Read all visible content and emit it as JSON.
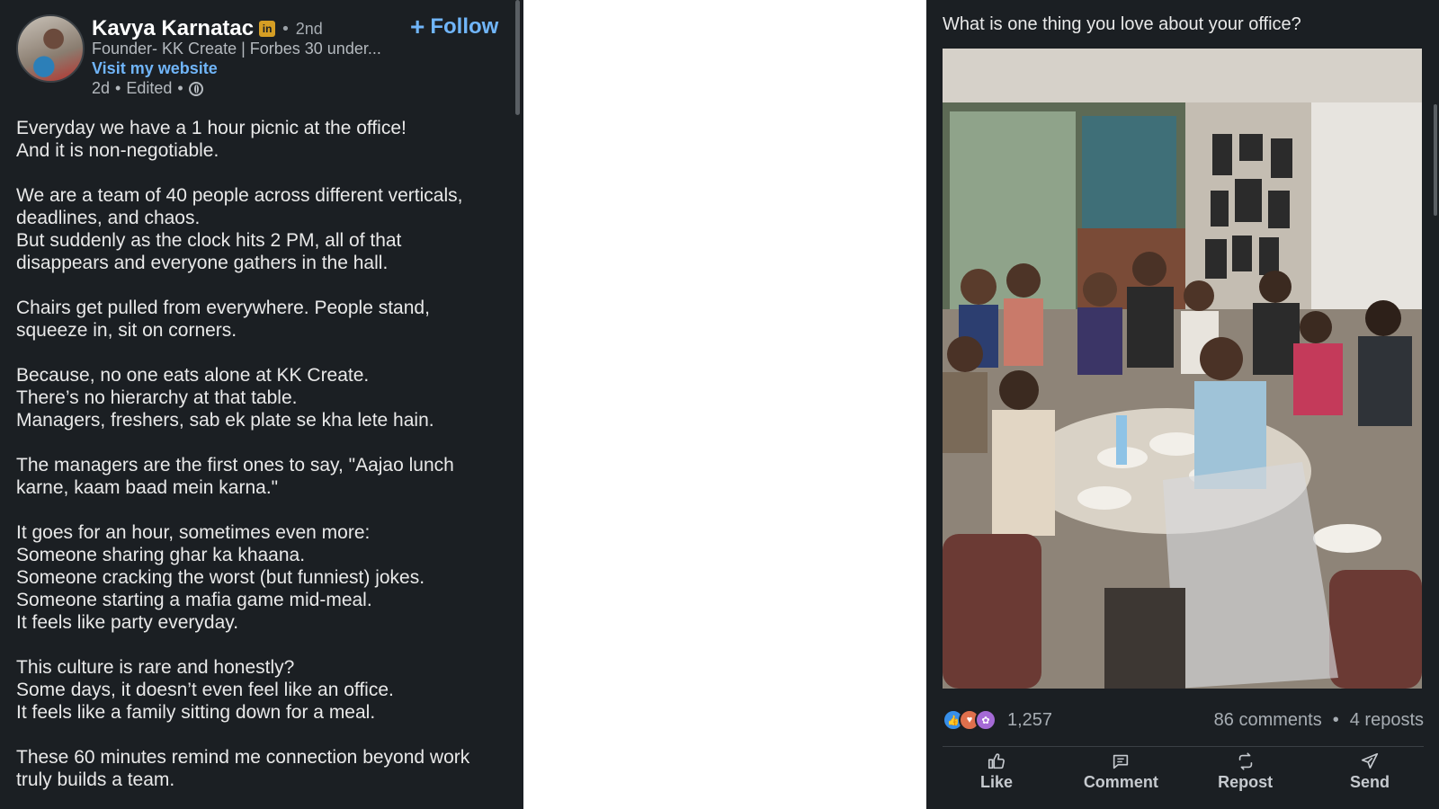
{
  "author": {
    "name": "Kavya Karnatac",
    "badge": "in",
    "degree": "2nd",
    "headline": "Founder- KK Create | Forbes 30 under...",
    "website_link": "Visit my website",
    "time": "2d",
    "edited": "Edited",
    "follow_label": "Follow"
  },
  "post": {
    "paragraphs": [
      "Everyday we have a 1 hour picnic at the office!\nAnd it is non-negotiable.",
      "We are a team of 40 people across different verticals,\ndeadlines, and chaos.\nBut suddenly as the clock hits 2 PM, all of that\ndisappears and everyone gathers in the hall.",
      "Chairs get pulled from everywhere. People stand,\nsqueeze in, sit on corners.",
      "Because, no one eats alone at KK Create.\nThere’s no hierarchy at that table.\nManagers, freshers, sab ek plate se kha lete hain.",
      "The managers are the first ones to say, \"Aajao lunch\nkarne, kaam baad mein karna.\"",
      "It goes for an hour, sometimes even more:\nSomeone sharing ghar ka khaana.\nSomeone cracking the worst (but funniest) jokes.\nSomeone starting a mafia game mid-meal.\nIt feels like party everyday.",
      "This culture is rare and honestly?\nSome days, it doesn’t even feel like an office.\nIt feels like a family sitting down for a meal.",
      "These 60 minutes remind me connection beyond work\ntruly builds a team."
    ],
    "question": "What is one thing you love about your office?"
  },
  "stats": {
    "reactions": "1,257",
    "comments": "86 comments",
    "reposts": "4 reposts",
    "reaction_icons": [
      "like-icon",
      "love-icon",
      "support-icon"
    ]
  },
  "actions": {
    "like": "Like",
    "comment": "Comment",
    "repost": "Repost",
    "send": "Send"
  },
  "colors": {
    "background": "#1b1f23",
    "link": "#70b5f9",
    "badge": "#d59e24"
  }
}
